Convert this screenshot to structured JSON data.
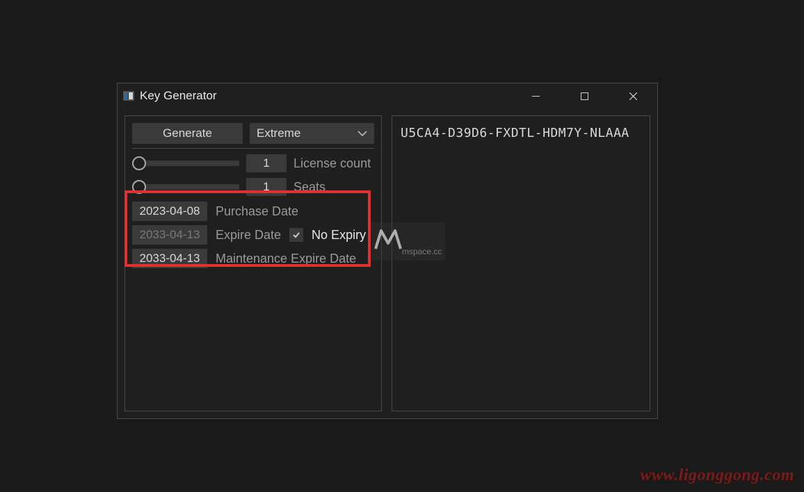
{
  "window": {
    "title": "Key Generator"
  },
  "controls": {
    "generate_label": "Generate",
    "tier_selected": "Extreme"
  },
  "license_count": {
    "value": "1",
    "label": "License count"
  },
  "seats": {
    "value": "1",
    "label": "Seats"
  },
  "purchase_date": {
    "value": "2023-04-08",
    "label": "Purchase Date"
  },
  "expire_date": {
    "value": "2033-04-13",
    "label": "Expire Date",
    "no_expiry_checked": true,
    "no_expiry_label": "No Expiry"
  },
  "maintenance_date": {
    "value": "2033-04-13",
    "label": "Maintenance Expire Date"
  },
  "output": {
    "key": "U5CA4-D39D6-FXDTL-HDM7Y-NLAAA"
  },
  "watermark": {
    "logo_text": "mspace.cc",
    "url": "www.ligonggong.com"
  }
}
